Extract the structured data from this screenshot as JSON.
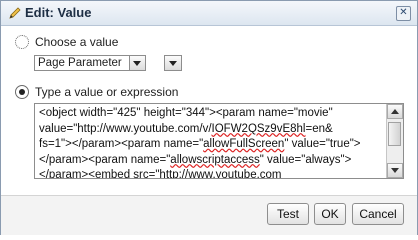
{
  "dialog": {
    "title": "Edit: Value"
  },
  "choose": {
    "label": "Choose a value",
    "select_value": "Page Parameter"
  },
  "type_value": {
    "label": "Type a value or expression",
    "content_parts": [
      "<object width=\"425\" height=\"344\"><param name=\"movie\"\nvalue=\"http://www.youtube.com/v/",
      "IOFW2QSz9vE8hl",
      "=en&\nfs=1\"></param><param name=\"",
      "allowFullScreen",
      "\" value=\"true\">\n</param><param name=\"",
      "allowscriptaccess",
      "\" value=\"always\">\n</param><embed src=\"http://www.youtube.com"
    ]
  },
  "buttons": {
    "test": "Test",
    "ok": "OK",
    "cancel": "Cancel"
  }
}
